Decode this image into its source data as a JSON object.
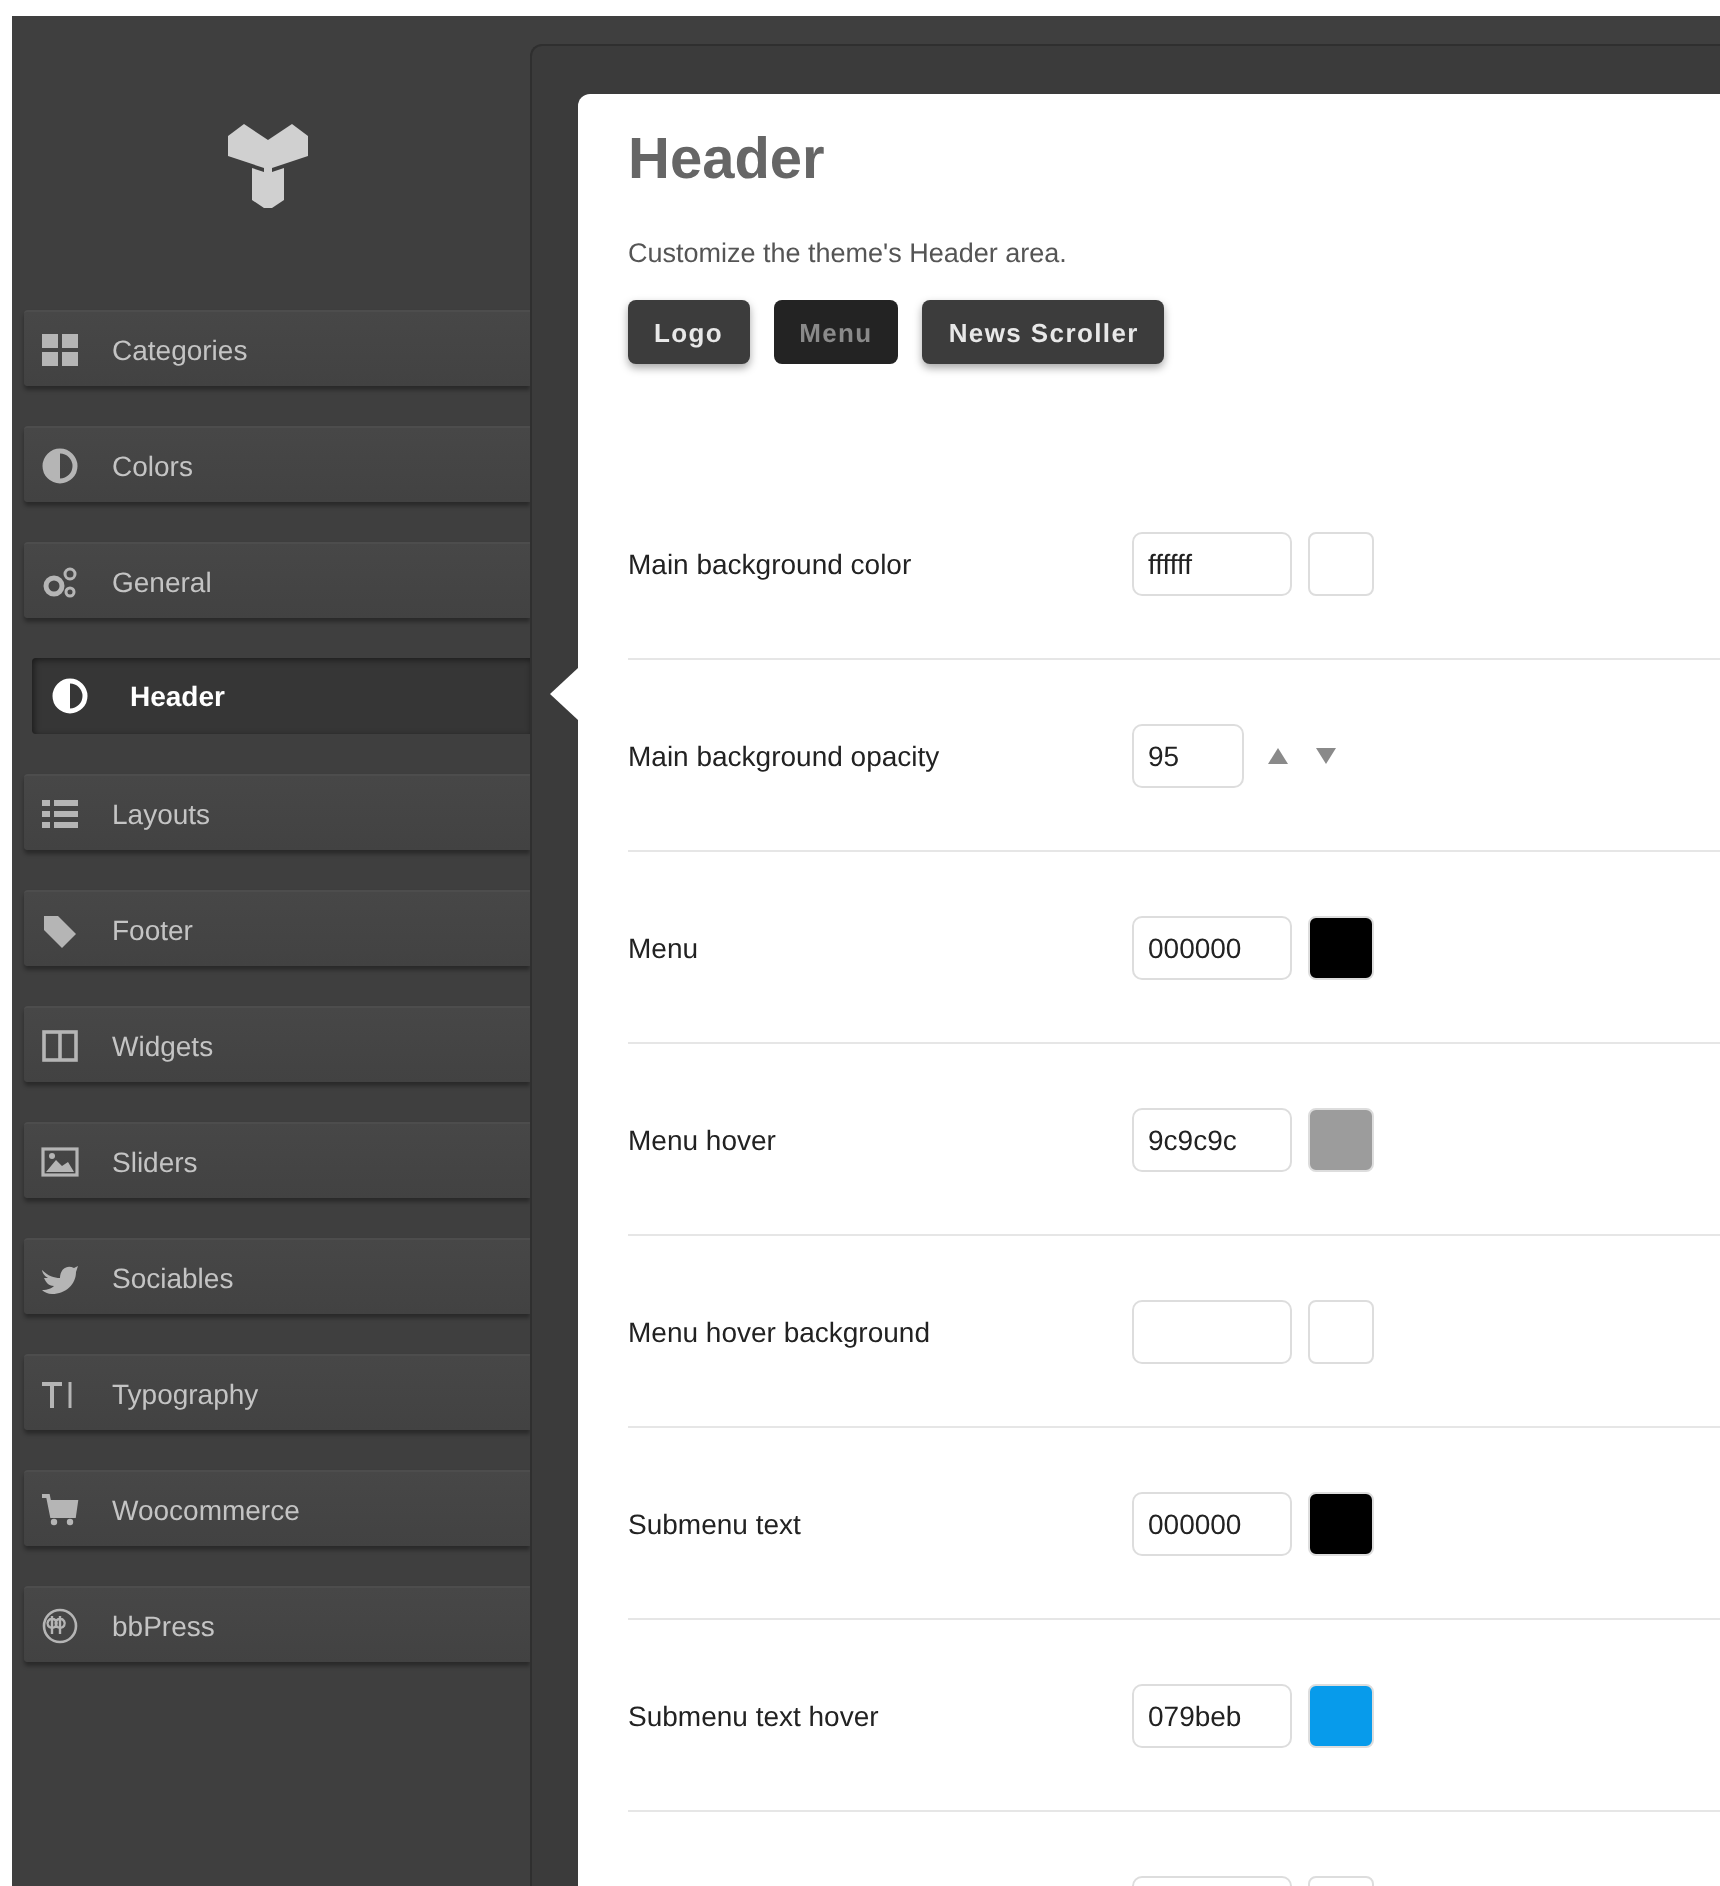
{
  "sidebar": {
    "items": [
      {
        "label": "Categories",
        "selected": false
      },
      {
        "label": "Colors",
        "selected": false
      },
      {
        "label": "General",
        "selected": false
      },
      {
        "label": "Header",
        "selected": true
      },
      {
        "label": "Layouts",
        "selected": false
      },
      {
        "label": "Footer",
        "selected": false
      },
      {
        "label": "Widgets",
        "selected": false
      },
      {
        "label": "Sliders",
        "selected": false
      },
      {
        "label": "Sociables",
        "selected": false
      },
      {
        "label": "Typography",
        "selected": false
      },
      {
        "label": "Woocommerce",
        "selected": false
      },
      {
        "label": "bbPress",
        "selected": false
      }
    ]
  },
  "page": {
    "title": "Header",
    "description": "Customize the theme's Header area.",
    "tabs": [
      {
        "label": "Logo",
        "selected": false
      },
      {
        "label": "Menu",
        "selected": true
      },
      {
        "label": "News Scroller",
        "selected": false
      }
    ]
  },
  "settings": [
    {
      "kind": "color",
      "label": "Main background color",
      "value": "ffffff",
      "color": "#ffffff"
    },
    {
      "kind": "number",
      "label": "Main background opacity",
      "value": "95"
    },
    {
      "kind": "color",
      "label": "Menu",
      "value": "000000",
      "color": "#000000"
    },
    {
      "kind": "color",
      "label": "Menu hover",
      "value": "9c9c9c",
      "color": "#9c9c9c"
    },
    {
      "kind": "color",
      "label": "Menu hover background",
      "color": "#ffffff"
    },
    {
      "kind": "color",
      "label": "Submenu text",
      "value": "000000",
      "color": "#000000"
    },
    {
      "kind": "color",
      "label": "Submenu text hover",
      "value": "079beb",
      "color": "#079beb"
    },
    {
      "kind": "color",
      "color": "#ffffff"
    }
  ]
}
